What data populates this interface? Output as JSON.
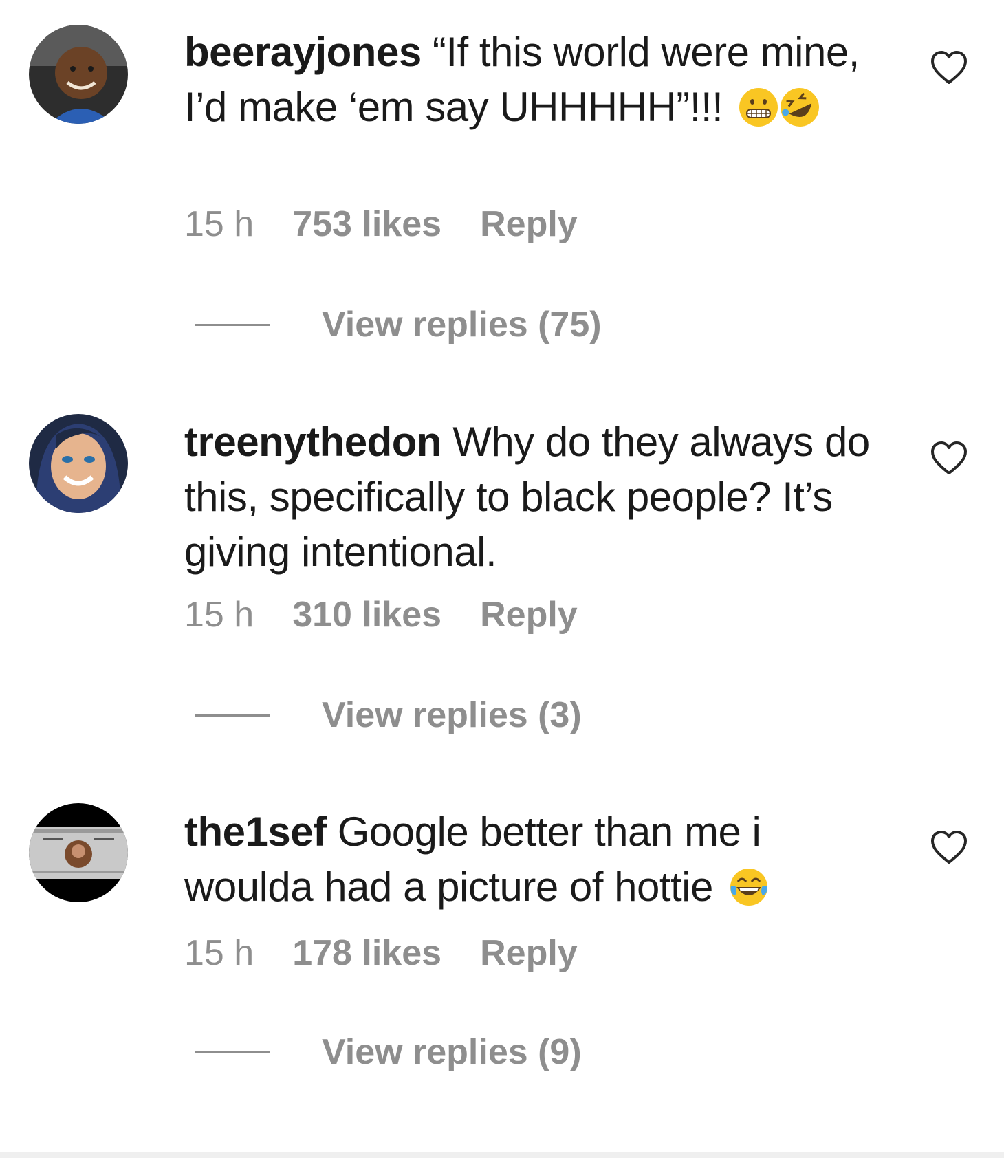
{
  "comments": [
    {
      "username": "beerayjones",
      "text": "“If this world were mine, I’d make ‘em say UHHHHH”!!!",
      "emoji": [
        "grimacing-face",
        "rolling-laughing-face"
      ],
      "time": "15 h",
      "likes": "753 likes",
      "reply_label": "Reply",
      "view_replies": "View replies (75)"
    },
    {
      "username": "treenythedon",
      "text": "Why do they always do this, specifically to black people? It’s giving intentional.",
      "emoji": [],
      "time": "15 h",
      "likes": "310 likes",
      "reply_label": "Reply",
      "view_replies": "View replies (3)"
    },
    {
      "username": "the1sef",
      "text": "Google better than me i woulda had a picture of hottie",
      "emoji": [
        "tears-of-joy-face"
      ],
      "time": "15 h",
      "likes": "178 likes",
      "reply_label": "Reply",
      "view_replies": "View replies (9)"
    }
  ],
  "colors": {
    "text": "#1a1a1a",
    "muted": "#8e8e8e",
    "background": "#ffffff"
  },
  "icons": {
    "like": "heart-outline-icon"
  }
}
